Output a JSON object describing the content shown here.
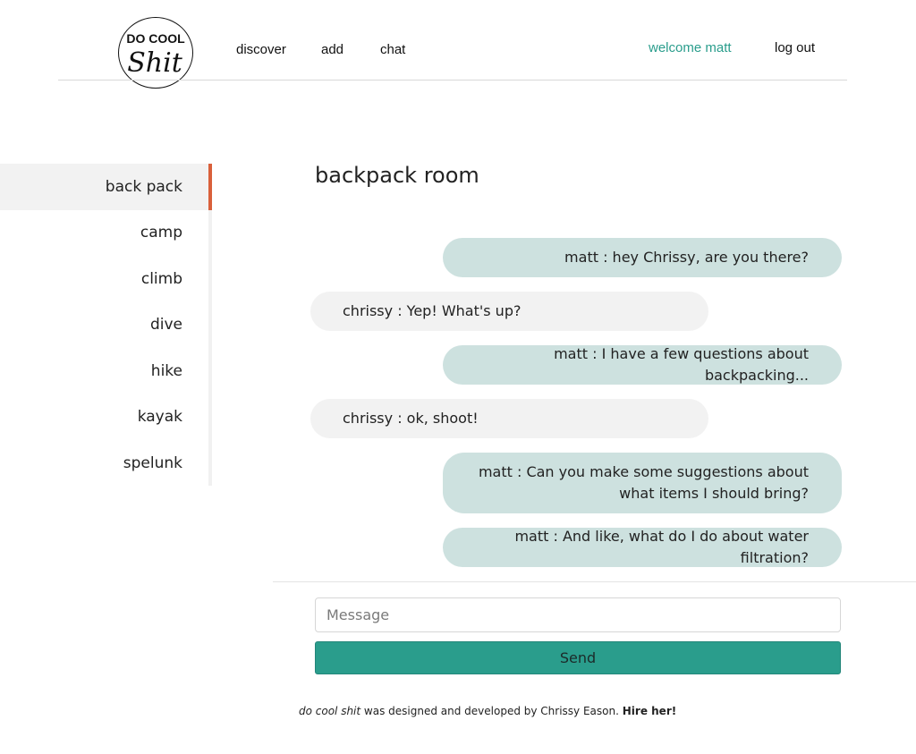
{
  "header": {
    "logo_text_top": "DO COOL",
    "logo_text_bottom": "Shit",
    "nav": [
      {
        "label": "discover"
      },
      {
        "label": "add"
      },
      {
        "label": "chat"
      }
    ],
    "welcome": "welcome matt",
    "logout": "log out",
    "accent_color": "#2a9d8c"
  },
  "sidebar": {
    "items": [
      {
        "label": "back pack",
        "active": true
      },
      {
        "label": "camp"
      },
      {
        "label": "climb"
      },
      {
        "label": "dive"
      },
      {
        "label": "hike"
      },
      {
        "label": "kayak"
      },
      {
        "label": "spelunk"
      }
    ],
    "active_color": "#d9603b"
  },
  "room": {
    "title": "backpack room",
    "messages": [
      {
        "from": "me",
        "text": "matt : hey Chrissy, are you there?"
      },
      {
        "from": "them",
        "text": "chrissy : Yep! What's up?"
      },
      {
        "from": "me",
        "text": "matt : I have a few questions about backpacking..."
      },
      {
        "from": "them",
        "text": "chrissy : ok, shoot!"
      },
      {
        "from": "me",
        "text": "matt : Can you make some suggestions about what items I should bring?"
      },
      {
        "from": "me",
        "text": "matt : And like, what do I do about water filtration?"
      }
    ]
  },
  "composer": {
    "placeholder": "Message",
    "value": "",
    "send_label": "Send"
  },
  "footer": {
    "brand": "do cool shit",
    "middle": " was designed and developed by ",
    "author": "Chrissy Eason",
    "period": ". ",
    "cta": "Hire her!"
  }
}
